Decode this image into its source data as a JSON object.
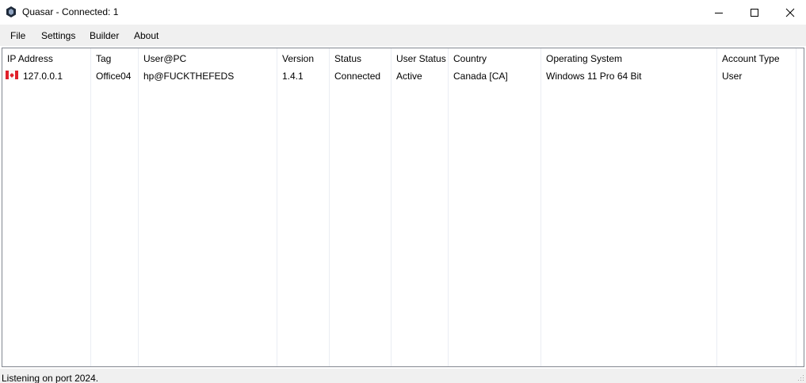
{
  "window": {
    "title": "Quasar - Connected: 1",
    "icon": "quasar-logo-icon"
  },
  "menu": {
    "items": [
      "File",
      "Settings",
      "Builder",
      "About"
    ]
  },
  "table": {
    "columns": [
      "IP Address",
      "Tag",
      "User@PC",
      "Version",
      "Status",
      "User Status",
      "Country",
      "Operating System",
      "Account Type"
    ],
    "rows": [
      {
        "flag_icon": "canada-flag-icon",
        "ip": "127.0.0.1",
        "tag": "Office04",
        "user_pc": "hp@FUCKTHEFEDS",
        "version": "1.4.1",
        "status": "Connected",
        "user_status": "Active",
        "country": "Canada [CA]",
        "os": "Windows 11 Pro 64 Bit",
        "account_type": "User"
      }
    ]
  },
  "statusbar": {
    "text": "Listening on port 2024."
  }
}
